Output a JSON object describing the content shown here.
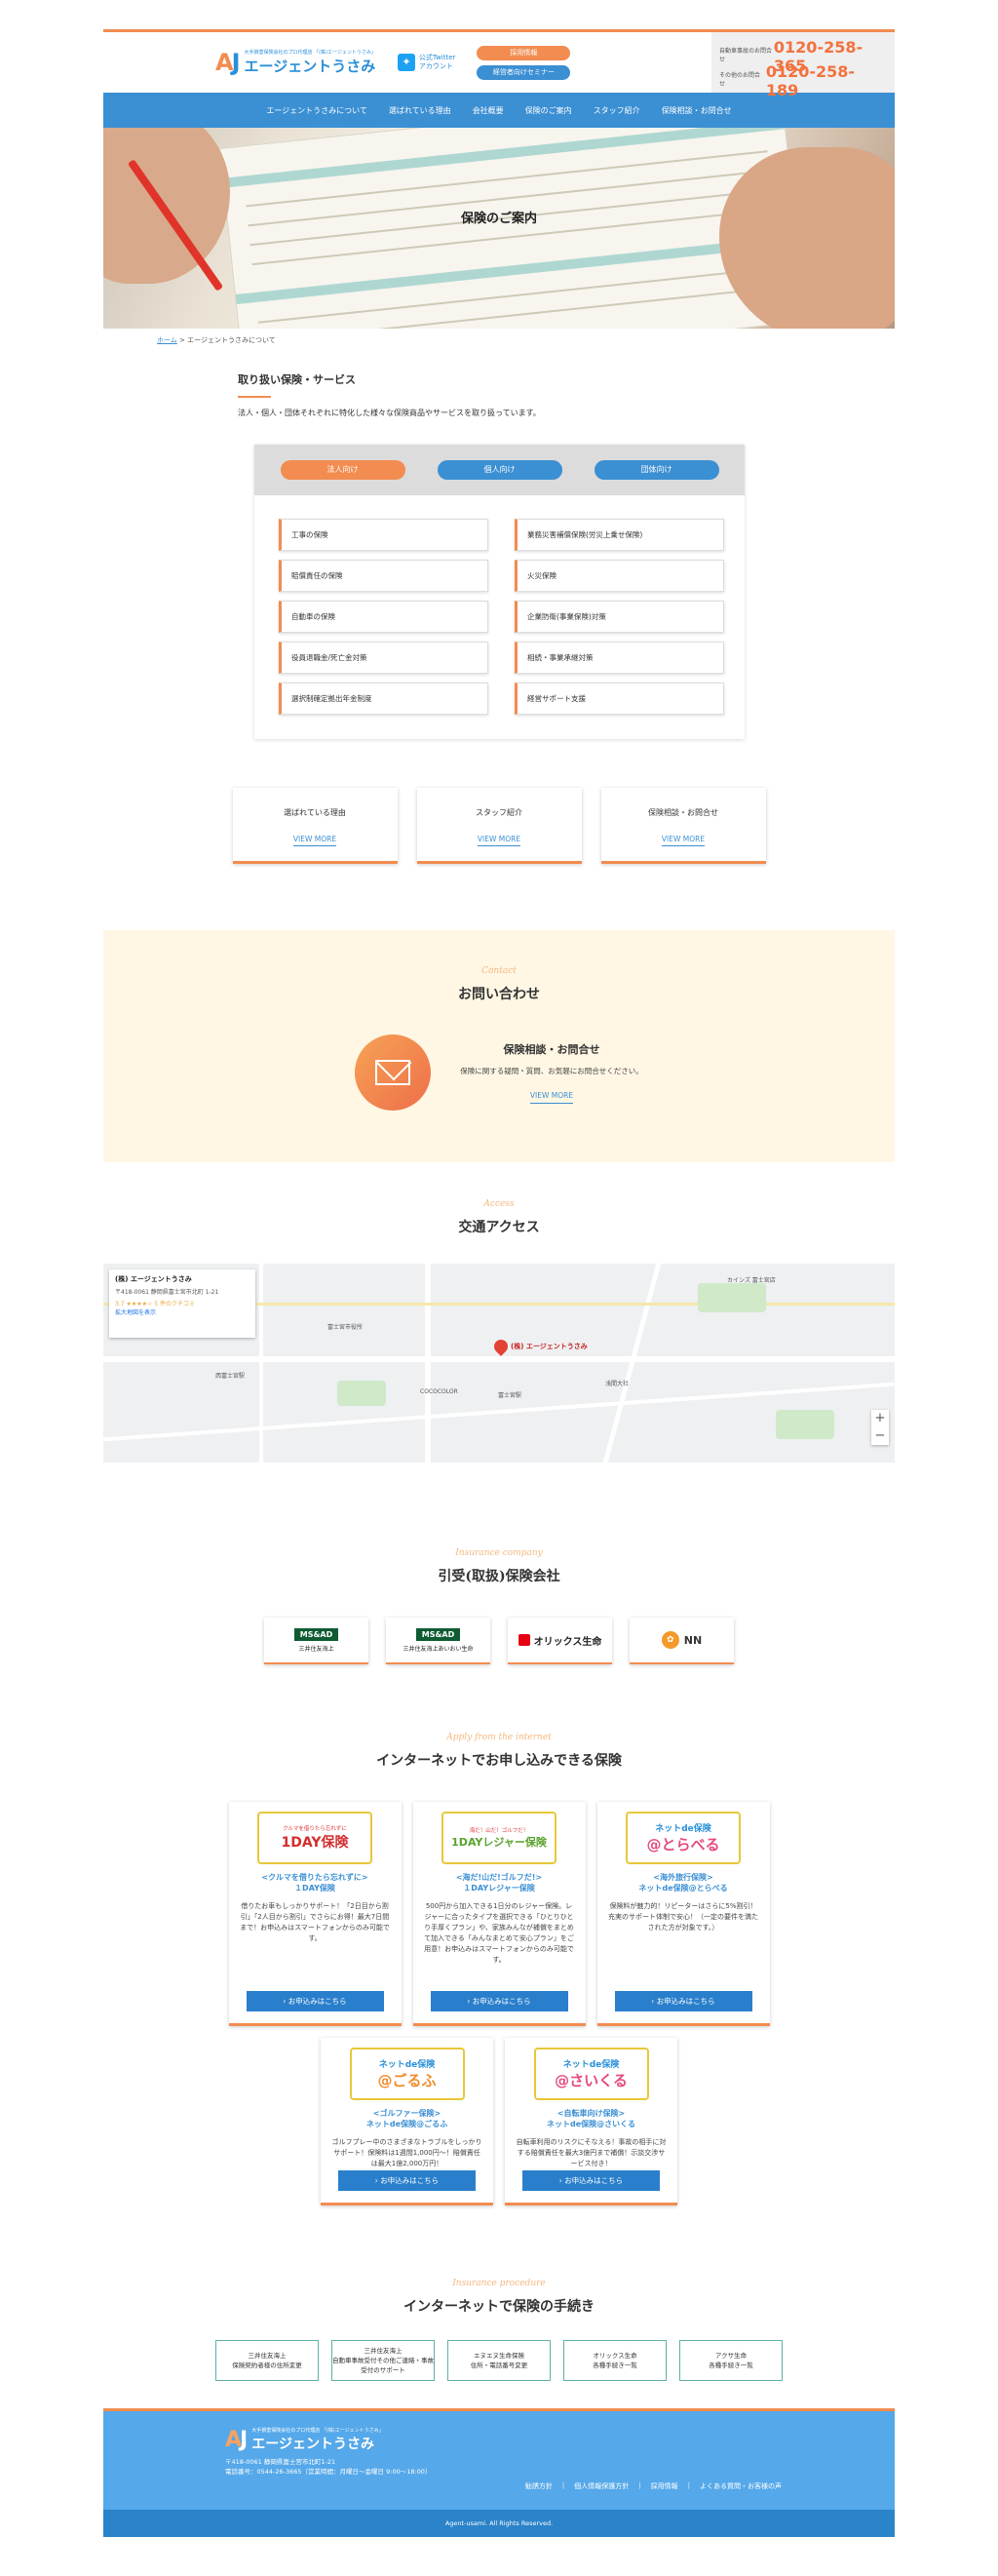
{
  "header": {
    "logo_mark_a": "A",
    "logo_mark_j": "J",
    "logo_sub": "大手損害保険会社のプロ代理店 「(株)エージェントうさみ」",
    "logo_name": "エージェントうさみ",
    "twitter_line1": "公式Twitter",
    "twitter_line2": "アカウント",
    "btn_recruit": "採用情報",
    "btn_seminar": "経営者向けセミナー",
    "phone1_label": "自動車事故のお問合せ",
    "phone1_number": "0120-258-365",
    "phone2_label": "その他のお問合せ",
    "phone2_number": "0120-258-189"
  },
  "nav": {
    "items": [
      "エージェントうさみについて",
      "選ばれている理由",
      "会社概要",
      "保険のご案内",
      "スタッフ紹介",
      "保険相談・お問合せ"
    ]
  },
  "hero": {
    "title": "保険のご案内"
  },
  "breadcrumb": {
    "home": "ホーム",
    "sep": " > ",
    "current": "エージェントうさみについて"
  },
  "services": {
    "heading": "取り扱い保険・サービス",
    "desc": "法人・個人・団体それぞれに特化した様々な保険商品やサービスを取り扱っています。",
    "tabs": [
      "法人向け",
      "個人向け",
      "団体向け"
    ],
    "items": [
      "工事の保険",
      "業務災害補償保険(労災上乗せ保険)",
      "賠償責任の保険",
      "火災保険",
      "自動車の保険",
      "企業防衛(事業保険)対策",
      "役員退職金/死亡金対策",
      "相続・事業承継対策",
      "選択制確定拠出年金制度",
      "経営サポート支援"
    ]
  },
  "feature_cards": [
    {
      "title": "選ばれている理由",
      "more": "VIEW MORE"
    },
    {
      "title": "スタッフ紹介",
      "more": "VIEW MORE"
    },
    {
      "title": "保険相談・お問合せ",
      "more": "VIEW MORE"
    }
  ],
  "contact": {
    "en": "Contact",
    "jp": "お問い合わせ",
    "title": "保険相談・お問合せ",
    "desc": "保険に関する疑問・質問、お気軽にお問合せください。",
    "more": "VIEW MORE"
  },
  "access": {
    "en": "Access",
    "jp": "交通アクセス",
    "map": {
      "name": "(株) エージェントうさみ",
      "address": "〒418-0061 静岡県富士宮市北町 1-21",
      "rating": "3.7 ★★★★☆ 5 件のクチコミ",
      "link": "拡大地図を表示",
      "pin_label": "(株) エージェントうさみ",
      "labels": [
        "富士宮市役所",
        "富士宮駅",
        "西富士宮駅",
        "浅間大社",
        "COCOCOLOR",
        "カインズ 富士宮店"
      ]
    }
  },
  "insurers": {
    "en": "Insurance company",
    "jp": "引受(取扱)保険会社",
    "logos": [
      {
        "badge": "MS&AD",
        "sub": "三井住友海上"
      },
      {
        "badge": "MS&AD",
        "sub": "三井住友海上あいおい生命"
      },
      {
        "text": "オリックス生命"
      },
      {
        "text": "NN"
      }
    ]
  },
  "apply": {
    "en": "Apply from the internet",
    "jp": "インターネットでお申し込みできる保険",
    "cards": [
      {
        "banner_top": "クルマを借りたら忘れずに",
        "banner_main": "1DAY保険",
        "title": "<クルマを借りたら忘れずに>\n１DAY保険",
        "desc": "借りたお車もしっかりサポート！「2日目から割引」「2人目から割引」でさらにお得！最大7日間まで！お申込みはスマートフォンからのみ可能です。",
        "btn": "お申込みはこちら"
      },
      {
        "banner_top": "海だ！山だ！ゴルフだ！",
        "banner_main": "1DAYレジャー保険",
        "title": "<海だ!山だ!ゴルフだ!>\n１DAYレジャー保険",
        "desc": "500円から加入できる1日分のレジャー保険。レジャーに合ったタイプを選択できる「ひとりひとり手厚くプラン」や、家族みんなが補償をまとめて加入できる「みんなまとめて安心プラン」をご用意！お申込みはスマートフォンからのみ可能です。",
        "btn": "お申込みはこちら"
      },
      {
        "banner_top": "ネットde保険",
        "banner_main": "@とらべる",
        "title": "<海外旅行保険>\nネットde保険@とらべる",
        "desc": "保険料が魅力的！リピーターはさらに5%割引！充実のサポート体制で安心！（一定の要件を満たされた方が対象です。）",
        "btn": "お申込みはこちら"
      },
      {
        "banner_top": "ネットde保険",
        "banner_main": "@ごるふ",
        "title": "<ゴルファー保険>\nネットde保険@ごるふ",
        "desc": "ゴルフプレー中のさまざまなトラブルをしっかりサポート！保険料は1週間1,000円～！賠償責任は最大1億2,000万円！",
        "btn": "お申込みはこちら"
      },
      {
        "banner_top": "ネットde保険",
        "banner_main": "@さいくる",
        "title": "<自転車向け保険>\nネットde保険@さいくる",
        "desc": "自転車利用のリスクにそなえる！事故の相手に対する賠償責任を最大3億円まで補償！示談交渉サービス付き！",
        "btn": "お申込みはこちら"
      }
    ]
  },
  "procedure": {
    "en": "Insurance procedure",
    "jp": "インターネットで保険の手続き",
    "items": [
      "三井住友海上\n保険契約者様の住所変更",
      "三井住友海上\n自動車事故受付その他ご連絡・事故受付のサポート",
      "エヌエヌ生命保険\n住所・電話番号変更",
      "オリックス生命\n各種手続き一覧",
      "アクサ生命\n各種手続き一覧"
    ]
  },
  "footer": {
    "logo_mark_a": "A",
    "logo_mark_j": "J",
    "logo_sub": "大手損害保険会社のプロ代理店 「(株)エージェントうさみ」",
    "logo_name": "エージェントうさみ",
    "address": "〒418-0061 静岡県富士宮市北町1-21",
    "phone": "電話番号：0544-26-3665（営業時間：月曜日～金曜日 9:00～18:00）",
    "links": [
      "勧誘方針",
      "個人情報保護方針",
      "採用情報",
      "よくある質問・お客様の声"
    ],
    "copyright": "Agent-usami. All Rights Reserved."
  }
}
